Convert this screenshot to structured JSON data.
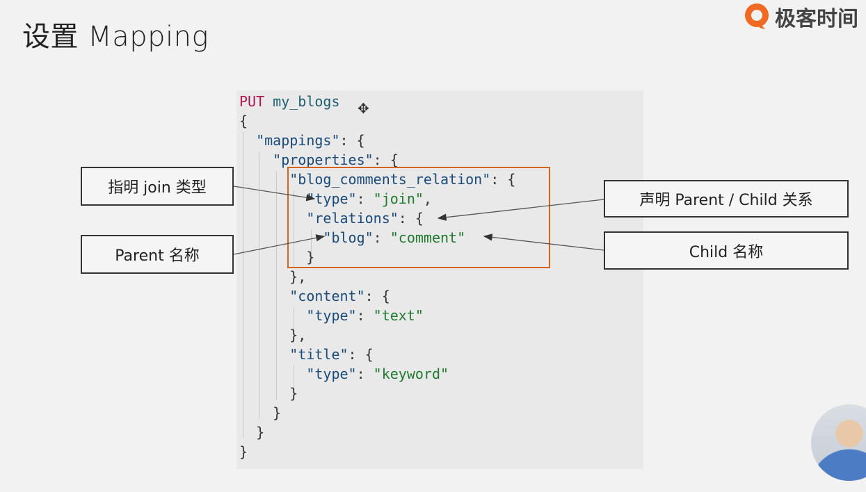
{
  "slide": {
    "title": "设置 Mapping"
  },
  "logo": {
    "text": "极客时间",
    "icon": "geektime-logo-icon",
    "brand_color": "#f06a23"
  },
  "code": {
    "line1_kw": "PUT",
    "line1_index": "my_blogs",
    "line2": "{",
    "line3_key": "\"mappings\"",
    "line3_rest": ": {",
    "line4_key": "\"properties\"",
    "line4_rest": ": {",
    "line5_key": "\"blog_comments_relation\"",
    "line5_rest": ": {",
    "line6_key": "\"type\"",
    "line6_mid": ": ",
    "line6_val": "\"join\"",
    "line6_end": ",",
    "line7_key": "\"relations\"",
    "line7_rest": ": {",
    "line8_key": "\"blog\"",
    "line8_mid": ": ",
    "line8_val": "\"comment\"",
    "line9": "}",
    "line10": "},",
    "line11_key": "\"content\"",
    "line11_rest": ": {",
    "line12_key": "\"type\"",
    "line12_mid": ": ",
    "line12_val": "\"text\"",
    "line13": "},",
    "line14_key": "\"title\"",
    "line14_rest": ": {",
    "line15_key": "\"type\"",
    "line15_mid": ": ",
    "line15_val": "\"keyword\"",
    "line16": "}",
    "line17": "}",
    "line18": "}",
    "line19": "}"
  },
  "callouts": {
    "join_type": "指明 join 类型",
    "parent_name": "Parent 名称",
    "declare_relation": "声明 Parent / Child 关系",
    "child_name": "Child 名称"
  },
  "colors": {
    "highlight_box": "#d4651e",
    "keyword": "#b0154f",
    "string": "#1f7a2e"
  }
}
